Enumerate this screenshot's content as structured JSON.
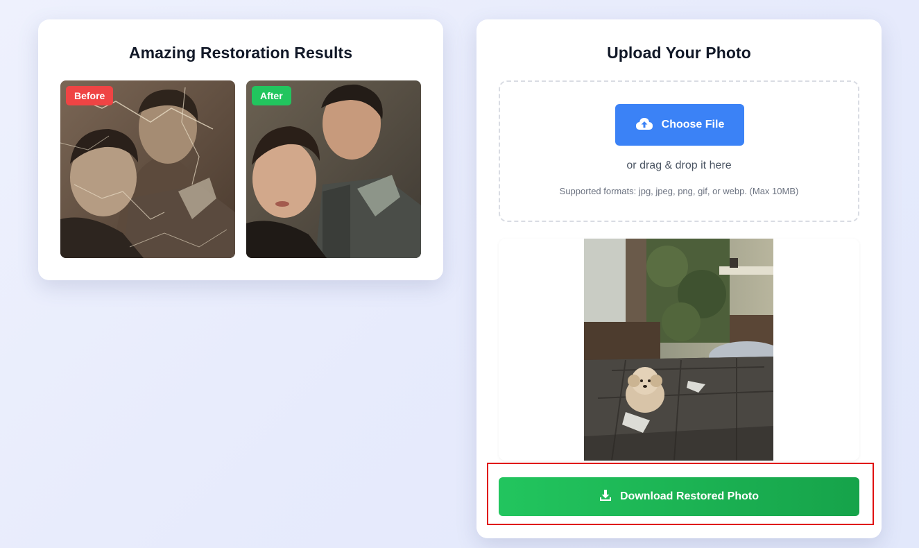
{
  "showcase": {
    "title": "Amazing Restoration Results",
    "before_label": "Before",
    "after_label": "After"
  },
  "upload": {
    "title": "Upload Your Photo",
    "choose_file_label": "Choose File",
    "drag_text": "or drag & drop it here",
    "formats_text": "Supported formats: jpg, jpeg, png, gif, or webp. (Max 10MB)",
    "download_label": "Download Restored Photo"
  },
  "colors": {
    "primary_blue": "#3b82f6",
    "success_green": "#22c55e",
    "badge_red": "#ef4444",
    "highlight_red": "#e01010"
  },
  "icons": {
    "choose_file": "cloud-upload-icon",
    "download": "download-icon"
  }
}
